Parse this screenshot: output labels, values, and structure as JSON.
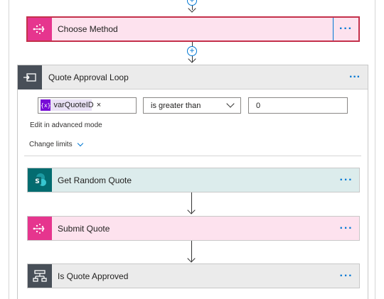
{
  "colors": {
    "accent": "#0078d4",
    "pink_card": "#fde2ee",
    "pink_icon": "#e6358e",
    "teal_card": "#dcecec",
    "teal_icon": "#036c70",
    "grey_card": "#ebebeb",
    "grey_icon": "#484f58",
    "selected_border": "#c4314b",
    "variable_token": "#770bd6"
  },
  "choose_method": {
    "title": "Choose Method",
    "icon": "flow-icon",
    "menu": "···"
  },
  "loop": {
    "title": "Quote Approval Loop",
    "icon": "loop-icon",
    "menu": "···",
    "condition": {
      "token_label": "varQuoteID",
      "token_icon_text": "{x}",
      "token_remove": "×",
      "operator": "is greater than",
      "value": "0"
    },
    "advanced_link": "Edit in advanced mode",
    "change_limits": "Change limits",
    "actions": [
      {
        "title": "Get Random Quote",
        "icon": "sharepoint-icon",
        "menu": "···"
      },
      {
        "title": "Submit Quote",
        "icon": "flow-icon",
        "menu": "···"
      },
      {
        "title": "Is Quote Approved",
        "icon": "condition-icon",
        "menu": "···"
      }
    ]
  },
  "connectors": {
    "add_step": "+"
  }
}
